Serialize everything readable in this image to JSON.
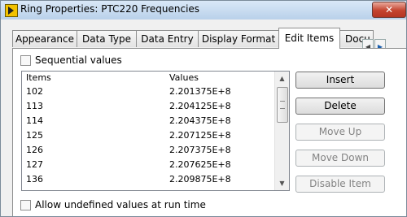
{
  "window": {
    "title": "Ring Properties: PTC220 Frequencies",
    "close_label": "✕"
  },
  "tabs": [
    {
      "label": "Appearance"
    },
    {
      "label": "Data Type"
    },
    {
      "label": "Data Entry"
    },
    {
      "label": "Display Format"
    },
    {
      "label": "Edit Items"
    },
    {
      "label": "Docu"
    }
  ],
  "active_tab": "Edit Items",
  "options": {
    "sequential_label": "Sequential values",
    "sequential_checked": false,
    "allow_undefined_label": "Allow undefined values at run time",
    "allow_undefined_checked": false
  },
  "table": {
    "columns": [
      "Items",
      "Values"
    ],
    "rows": [
      [
        "102",
        "2.201375E+8"
      ],
      [
        "113",
        "2.204125E+8"
      ],
      [
        "114",
        "2.204375E+8"
      ],
      [
        "125",
        "2.207125E+8"
      ],
      [
        "126",
        "2.207375E+8"
      ],
      [
        "127",
        "2.207625E+8"
      ],
      [
        "136",
        "2.209875E+8"
      ]
    ]
  },
  "buttons": {
    "insert": "Insert",
    "delete": "Delete",
    "move_up": "Move Up",
    "move_down": "Move Down",
    "disable_item": "Disable Item"
  },
  "icons": [
    "app-icon",
    "close-icon",
    "tab-scroll-left-icon",
    "tab-scroll-right-icon",
    "scroll-up-icon",
    "scroll-down-icon"
  ]
}
